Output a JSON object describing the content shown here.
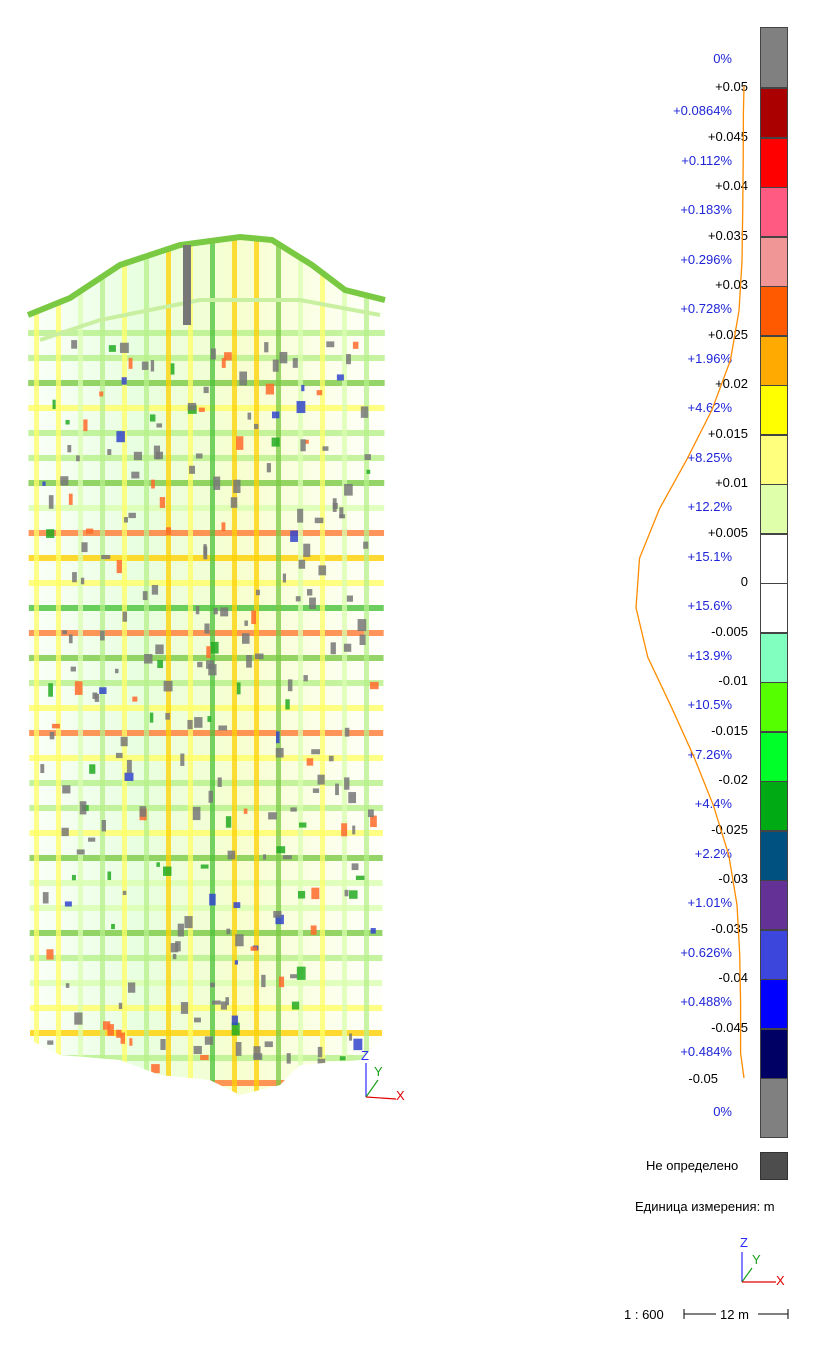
{
  "legend": {
    "top_percent": "0%",
    "bottom_percent": "0%",
    "classes": [
      {
        "upper": "+0.05",
        "percent": "+0.0864%",
        "color": "#aa0000"
      },
      {
        "upper": "+0.045",
        "percent": "+0.112%",
        "color": "#ff0000"
      },
      {
        "upper": "+0.04",
        "percent": "+0.183%",
        "color": "#ff5a82"
      },
      {
        "upper": "+0.035",
        "percent": "+0.296%",
        "color": "#f09696"
      },
      {
        "upper": "+0.03",
        "percent": "+0.728%",
        "color": "#ff5a00"
      },
      {
        "upper": "+0.025",
        "percent": "+1.96%",
        "color": "#ffaa00"
      },
      {
        "upper": "+0.02",
        "percent": "+4.62%",
        "color": "#ffff00"
      },
      {
        "upper": "+0.015",
        "percent": "+8.25%",
        "color": "#ffff7d"
      },
      {
        "upper": "+0.01",
        "percent": "+12.2%",
        "color": "#e0ffaa"
      },
      {
        "upper": "+0.005",
        "percent": "+15.1%",
        "color": "#ffffff"
      },
      {
        "upper": "0",
        "percent": "+15.6%",
        "color": "#ffffff"
      },
      {
        "upper": "-0.005",
        "percent": "+13.9%",
        "color": "#80ffbf"
      },
      {
        "upper": "-0.01",
        "percent": "+10.5%",
        "color": "#55ff00"
      },
      {
        "upper": "-0.015",
        "percent": "+7.26%",
        "color": "#00ff28"
      },
      {
        "upper": "-0.02",
        "percent": "+4.4%",
        "color": "#00aa14"
      },
      {
        "upper": "-0.025",
        "percent": "+2.2%",
        "color": "#005080"
      },
      {
        "upper": "-0.03",
        "percent": "+1.01%",
        "color": "#643296"
      },
      {
        "upper": "-0.035",
        "percent": "+0.626%",
        "color": "#3c46dc"
      },
      {
        "upper": "-0.04",
        "percent": "+0.488%",
        "color": "#0000ff"
      },
      {
        "upper": "-0.045",
        "percent": "+0.484%",
        "color": "#000064"
      }
    ],
    "bottom_value": "-0.05",
    "overflow_color": "#808080",
    "curve_color": "#ff8c00"
  },
  "undefined_label": "Не определено",
  "unit_label": "Единица измерения: m",
  "axes": {
    "z": "Z",
    "y": "Y",
    "x": "X"
  },
  "scale": {
    "ratio": "1 : 600",
    "bar_label": "12 m"
  }
}
